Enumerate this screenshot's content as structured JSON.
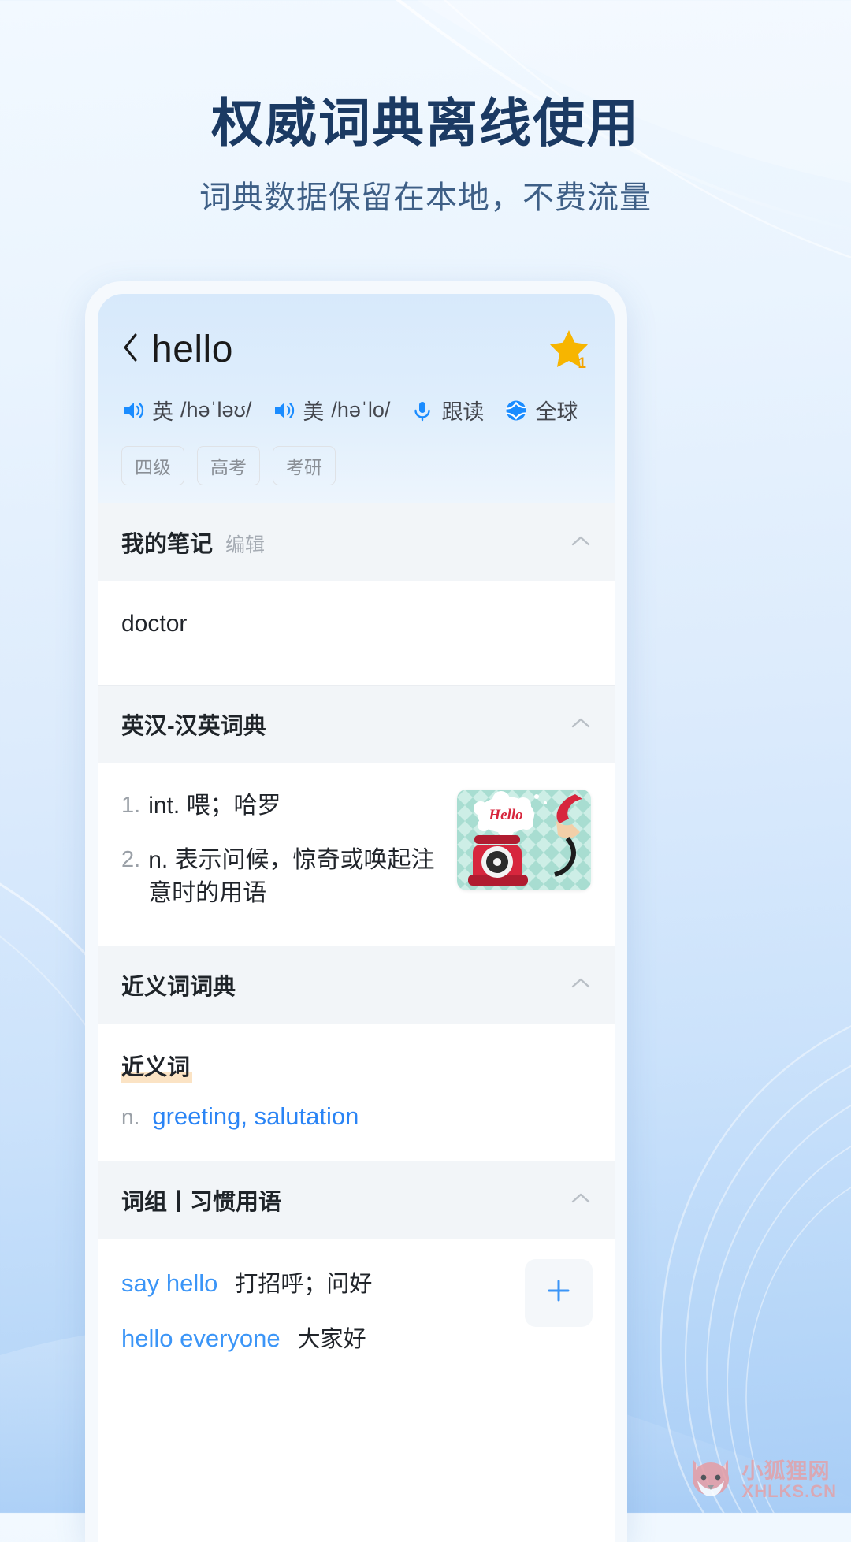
{
  "hero": {
    "title": "权威词典离线使用",
    "subtitle": "词典数据保留在本地，不费流量"
  },
  "colors": {
    "accent_blue": "#1a8cff",
    "link_blue": "#2a84f5",
    "title_navy": "#1b3a63",
    "subtitle_blue": "#3e5f86",
    "star_gold": "#f7b500",
    "highlight_peach": "#fbe3c4",
    "watermark_pink": "#e4a0a6"
  },
  "word_header": {
    "back_icon": "chevron-left-icon",
    "word": "hello",
    "favorite_icon": "star-icon",
    "favorite_badge": "1",
    "pronunciations": [
      {
        "icon": "speaker-icon",
        "label": "英",
        "ipa": "/həˈləʊ/"
      },
      {
        "icon": "speaker-icon",
        "label": "美",
        "ipa": "/həˈlo/"
      }
    ],
    "actions": [
      {
        "icon": "microphone-icon",
        "label": "跟读"
      },
      {
        "icon": "globe-icon",
        "label": "全球"
      }
    ],
    "tags": [
      "四级",
      "高考",
      "考研"
    ]
  },
  "sections": {
    "notes": {
      "title": "我的笔记",
      "action": "编辑",
      "collapse_icon": "chevron-up-icon",
      "content": "doctor"
    },
    "dictionary": {
      "title": "英汉-汉英词典",
      "collapse_icon": "chevron-up-icon",
      "entries": [
        {
          "num": "1.",
          "pos": "int.",
          "text": "喂；哈罗"
        },
        {
          "num": "2.",
          "pos": "n.",
          "text": "表示问候，惊奇或唤起注意时的用语"
        }
      ],
      "illustration": {
        "name": "hello-telephone-illustration",
        "caption": "Hello"
      }
    },
    "synonyms": {
      "title": "近义词词典",
      "collapse_icon": "chevron-up-icon",
      "label": "近义词",
      "pos": "n.",
      "words": "greeting, salutation"
    },
    "phrases": {
      "title": "词组丨习惯用语",
      "collapse_icon": "chevron-up-icon",
      "add_icon": "plus-icon",
      "items": [
        {
          "en": "say hello",
          "cn": "打招呼；问好"
        },
        {
          "en": "hello everyone",
          "cn": "大家好"
        }
      ]
    }
  },
  "watermark": {
    "icon": "fox-face-icon",
    "cn": "小狐狸网",
    "en": "XHLKS.CN"
  }
}
